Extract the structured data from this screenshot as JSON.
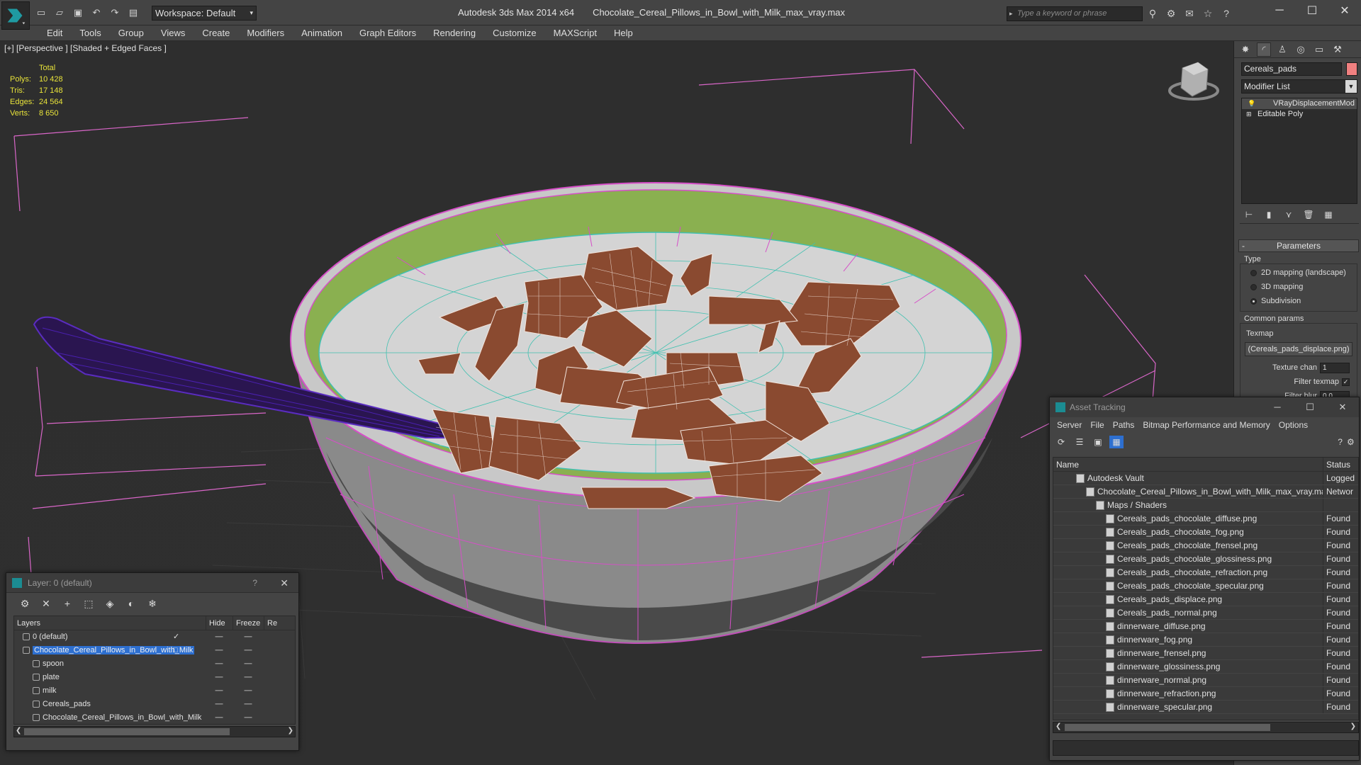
{
  "app": {
    "title": "Autodesk 3ds Max  2014 x64",
    "file": "Chocolate_Cereal_Pillows_in_Bowl_with_Milk_max_vray.max",
    "workspace": "Workspace: Default",
    "search_placeholder": "Type a keyword or phrase"
  },
  "menu": [
    "Edit",
    "Tools",
    "Group",
    "Views",
    "Create",
    "Modifiers",
    "Animation",
    "Graph Editors",
    "Rendering",
    "Customize",
    "MAXScript",
    "Help"
  ],
  "viewport": {
    "label": "[+] [Perspective ] [Shaded + Edged Faces ]",
    "stats_header": "Total",
    "stats": [
      {
        "label": "Polys:",
        "value": "10 428"
      },
      {
        "label": "Tris:",
        "value": "17 148"
      },
      {
        "label": "Edges:",
        "value": "24 564"
      },
      {
        "label": "Verts:",
        "value": "8 650"
      }
    ]
  },
  "command_panel": {
    "object_name": "Cereals_pads",
    "object_color": "#f08080",
    "modifier_list": "Modifier List",
    "stack": [
      "VRayDisplacementMod",
      "Editable Poly"
    ],
    "rollout_title": "Parameters",
    "type_label": "Type",
    "type_options": [
      "2D mapping (landscape)",
      "3D mapping",
      "Subdivision"
    ],
    "type_selected": 2,
    "common_label": "Common params",
    "texmap_label": "Texmap",
    "texmap_value": "(Cereals_pads_displace.png)",
    "texture_chan_label": "Texture chan",
    "texture_chan_value": "1",
    "filter_texmap_label": "Filter texmap",
    "filter_blur_label": "Filter blur",
    "filter_blur_value": "0.0"
  },
  "layer_window": {
    "title": "Layer: 0 (default)",
    "help": "?",
    "columns": [
      "Layers",
      "Hide",
      "Freeze",
      "Re"
    ],
    "rows": [
      {
        "name": "0 (default)",
        "indent": 1,
        "selected": false,
        "check": "✓"
      },
      {
        "name": "Chocolate_Cereal_Pillows_in_Bowl_with_Milk",
        "indent": 1,
        "selected": true,
        "check": "□"
      },
      {
        "name": "spoon",
        "indent": 2,
        "selected": false,
        "check": ""
      },
      {
        "name": "plate",
        "indent": 2,
        "selected": false,
        "check": ""
      },
      {
        "name": "milk",
        "indent": 2,
        "selected": false,
        "check": ""
      },
      {
        "name": "Cereals_pads",
        "indent": 2,
        "selected": false,
        "check": ""
      },
      {
        "name": "Chocolate_Cereal_Pillows_in_Bowl_with_Milk",
        "indent": 2,
        "selected": false,
        "check": ""
      }
    ]
  },
  "asset_window": {
    "title": "Asset Tracking",
    "menu": [
      "Server",
      "File",
      "Paths",
      "Bitmap Performance and Memory",
      "Options"
    ],
    "columns": [
      "Name",
      "Status"
    ],
    "rows": [
      {
        "name": "Autodesk Vault",
        "indent": 2,
        "status": "Logged"
      },
      {
        "name": "Chocolate_Cereal_Pillows_in_Bowl_with_Milk_max_vray.max",
        "indent": 3,
        "status": "Networ"
      },
      {
        "name": "Maps / Shaders",
        "indent": 4,
        "status": ""
      },
      {
        "name": "Cereals_pads_chocolate_diffuse.png",
        "indent": 5,
        "status": "Found"
      },
      {
        "name": "Cereals_pads_chocolate_fog.png",
        "indent": 5,
        "status": "Found"
      },
      {
        "name": "Cereals_pads_chocolate_frensel.png",
        "indent": 5,
        "status": "Found"
      },
      {
        "name": "Cereals_pads_chocolate_glossiness.png",
        "indent": 5,
        "status": "Found"
      },
      {
        "name": "Cereals_pads_chocolate_refraction.png",
        "indent": 5,
        "status": "Found"
      },
      {
        "name": "Cereals_pads_chocolate_specular.png",
        "indent": 5,
        "status": "Found"
      },
      {
        "name": "Cereals_pads_displace.png",
        "indent": 5,
        "status": "Found"
      },
      {
        "name": "Cereals_pads_normal.png",
        "indent": 5,
        "status": "Found"
      },
      {
        "name": "dinnerware_diffuse.png",
        "indent": 5,
        "status": "Found"
      },
      {
        "name": "dinnerware_fog.png",
        "indent": 5,
        "status": "Found"
      },
      {
        "name": "dinnerware_frensel.png",
        "indent": 5,
        "status": "Found"
      },
      {
        "name": "dinnerware_glossiness.png",
        "indent": 5,
        "status": "Found"
      },
      {
        "name": "dinnerware_normal.png",
        "indent": 5,
        "status": "Found"
      },
      {
        "name": "dinnerware_refraction.png",
        "indent": 5,
        "status": "Found"
      },
      {
        "name": "dinnerware_specular.png",
        "indent": 5,
        "status": "Found"
      }
    ]
  },
  "colors": {
    "selection": "#2d6fd0",
    "stats": "#e8e33a",
    "wire_pink": "#e050d0",
    "wire_cyan": "#40c0b0",
    "cereal": "#8a4a30",
    "bowl_inner": "#8ab050"
  }
}
